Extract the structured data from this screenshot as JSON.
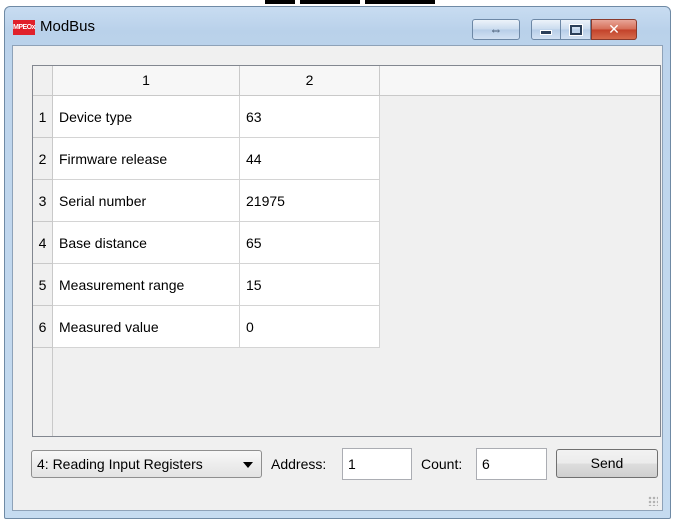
{
  "window": {
    "title": "ModBus",
    "app_icon_text": "MPEOx",
    "controls": {
      "resize_icon": "double-arrow-icon",
      "minimize_icon": "minimize-icon",
      "maximize_icon": "maximize-icon",
      "close_icon": "close-icon"
    }
  },
  "grid": {
    "columns": [
      "1",
      "2"
    ],
    "rows": [
      {
        "index": "1",
        "name": "Device type",
        "value": "63"
      },
      {
        "index": "2",
        "name": "Firmware release",
        "value": "44"
      },
      {
        "index": "3",
        "name": "Serial number",
        "value": "21975"
      },
      {
        "index": "4",
        "name": "Base distance",
        "value": "65"
      },
      {
        "index": "5",
        "name": "Measurement range",
        "value": "15"
      },
      {
        "index": "6",
        "name": "Measured value",
        "value": "0"
      }
    ]
  },
  "controls": {
    "function_select": "4: Reading Input Registers",
    "address_label": "Address:",
    "address_value": "1",
    "count_label": "Count:",
    "count_value": "6",
    "send_label": "Send"
  },
  "colors": {
    "frame": "#b9d1ea",
    "close_button": "#c2412a",
    "app_icon": "#e0202a"
  }
}
